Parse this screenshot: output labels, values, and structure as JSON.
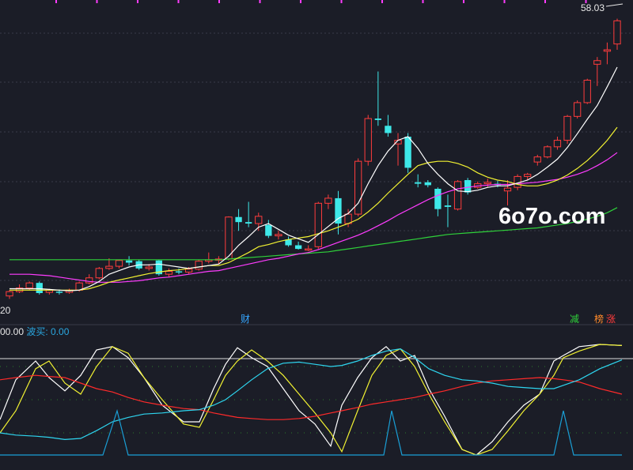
{
  "chart_data": {
    "type": "candlestick",
    "labels": {
      "high_price": "58.03",
      "left_value": "20",
      "finance_marker": "财",
      "reduce_marker": "减",
      "list_marker": "榜",
      "rise_marker": "涨",
      "indicator_value1": "00.00",
      "indicator_name": "波买:",
      "indicator_value2": " 0.00",
      "watermark": "6o7o.com"
    },
    "price_range": [
      18,
      60
    ],
    "indicator_range": [
      0,
      100
    ],
    "colors": {
      "background": "#1b1d27",
      "up": "#ff3c3c",
      "down": "#3ee8e8",
      "ma_fast": "#ffffff",
      "ma_mid": "#f2f232",
      "ma_slow": "#ff3cff",
      "ma_long": "#2fd23a",
      "k_line": "#ffffff",
      "d_line": "#f2f232",
      "slow_line": "#ff2a2a",
      "cyan_line": "#2ed6f0",
      "signal_line": "#1a9fd6",
      "grid": "#8a2a6a",
      "level_line": "#dddddd"
    },
    "candles": [
      [
        20.0,
        20.8,
        19.6,
        20.6
      ],
      [
        20.6,
        21.6,
        20.4,
        21.1
      ],
      [
        21.1,
        22.0,
        20.8,
        21.8
      ],
      [
        21.8,
        22.0,
        20.2,
        20.4
      ],
      [
        20.5,
        21.0,
        20.2,
        20.8
      ],
      [
        20.6,
        20.9,
        20.2,
        20.5
      ],
      [
        20.5,
        21.0,
        20.3,
        20.8
      ],
      [
        20.8,
        22.0,
        20.6,
        21.8
      ],
      [
        21.8,
        23.0,
        21.6,
        22.5
      ],
      [
        22.5,
        24.0,
        22.3,
        23.8
      ],
      [
        23.8,
        25.2,
        23.6,
        24.1
      ],
      [
        24.1,
        25.0,
        23.8,
        24.9
      ],
      [
        24.9,
        25.5,
        24.2,
        24.6
      ],
      [
        24.8,
        25.0,
        23.6,
        23.8
      ],
      [
        23.8,
        24.4,
        23.5,
        24.0
      ],
      [
        24.9,
        25.0,
        22.8,
        23.0
      ],
      [
        23.0,
        23.8,
        22.6,
        23.4
      ],
      [
        23.4,
        23.8,
        23.0,
        23.3
      ],
      [
        23.3,
        24.0,
        23.0,
        23.7
      ],
      [
        23.7,
        25.0,
        23.5,
        24.8
      ],
      [
        24.8,
        26.0,
        24.5,
        25.0
      ],
      [
        25.0,
        25.5,
        24.4,
        25.1
      ],
      [
        25.1,
        31.0,
        24.9,
        30.9
      ],
      [
        30.9,
        32.0,
        29.0,
        30.2
      ],
      [
        30.2,
        33.0,
        29.5,
        30.0
      ],
      [
        30.0,
        31.5,
        29.0,
        31.0
      ],
      [
        29.8,
        30.5,
        28.0,
        28.3
      ],
      [
        28.3,
        29.0,
        27.8,
        28.5
      ],
      [
        27.8,
        28.2,
        26.8,
        27.0
      ],
      [
        27.0,
        27.5,
        26.4,
        26.5
      ],
      [
        26.5,
        27.0,
        26.2,
        26.5
      ],
      [
        26.8,
        33.0,
        26.5,
        32.8
      ],
      [
        32.8,
        34.0,
        32.0,
        33.5
      ],
      [
        33.5,
        34.5,
        28.5,
        30.0
      ],
      [
        30.0,
        32.0,
        29.5,
        31.3
      ],
      [
        31.3,
        39.0,
        31.0,
        38.6
      ],
      [
        38.6,
        45.0,
        38.0,
        44.5
      ],
      [
        44.5,
        51.0,
        43.5,
        44.3
      ],
      [
        43.5,
        45.0,
        42.0,
        42.5
      ],
      [
        41.0,
        42.5,
        38.0,
        41.5
      ],
      [
        42.0,
        42.5,
        37.0,
        37.7
      ],
      [
        35.7,
        36.8,
        35.0,
        35.5
      ],
      [
        35.7,
        36.0,
        35.0,
        35.3
      ],
      [
        34.8,
        35.0,
        31.0,
        32.0
      ],
      [
        32.5,
        34.0,
        29.5,
        32.3
      ],
      [
        32.0,
        36.0,
        31.8,
        35.8
      ],
      [
        36.0,
        36.3,
        34.0,
        34.3
      ],
      [
        35.0,
        35.8,
        34.8,
        35.5
      ],
      [
        35.5,
        36.2,
        35.0,
        35.7
      ],
      [
        35.5,
        35.9,
        35.0,
        35.3
      ],
      [
        34.5,
        36.0,
        32.5,
        34.9
      ],
      [
        35.0,
        36.8,
        34.6,
        36.5
      ],
      [
        36.5,
        37.0,
        36.0,
        36.8
      ],
      [
        38.5,
        39.5,
        38.0,
        39.2
      ],
      [
        39.2,
        40.8,
        39.0,
        40.6
      ],
      [
        40.6,
        42.0,
        40.2,
        41.5
      ],
      [
        41.5,
        45.0,
        41.0,
        44.8
      ],
      [
        44.8,
        47.0,
        44.5,
        46.7
      ],
      [
        46.7,
        50.0,
        46.5,
        49.8
      ],
      [
        52.0,
        53.0,
        49.0,
        52.5
      ],
      [
        53.8,
        55.0,
        52.0,
        54.0
      ],
      [
        54.8,
        58.3,
        54.0,
        58.0
      ]
    ],
    "ma5": [
      21.0,
      21.0,
      21.0,
      21.0,
      20.9,
      20.8,
      20.7,
      20.8,
      21.3,
      22.0,
      23.0,
      23.5,
      24.0,
      24.3,
      24.3,
      24.4,
      24.2,
      24.0,
      23.8,
      24.0,
      24.2,
      24.4,
      25.5,
      27.0,
      28.2,
      29.5,
      30.0,
      29.2,
      28.4,
      27.9,
      27.4,
      28.5,
      29.6,
      30.7,
      31.4,
      32.8,
      35.5,
      38.0,
      40.0,
      41.5,
      42.0,
      40.4,
      38.3,
      36.8,
      35.5,
      34.5,
      34.4,
      34.6,
      35.0,
      35.2,
      35.2,
      35.6,
      36.0,
      36.8,
      37.8,
      38.9,
      40.5,
      42.4,
      44.4,
      46.3,
      48.9,
      51.6
    ],
    "ma10": [
      20.8,
      20.8,
      20.8,
      20.8,
      20.8,
      20.8,
      20.8,
      20.8,
      21.0,
      21.4,
      21.9,
      22.2,
      22.5,
      22.8,
      23.1,
      23.3,
      23.5,
      23.6,
      23.8,
      24.0,
      24.2,
      24.2,
      24.6,
      25.3,
      26.0,
      26.8,
      27.1,
      27.5,
      27.8,
      28.0,
      28.2,
      28.6,
      29.0,
      29.5,
      30.0,
      30.6,
      31.6,
      32.8,
      34.2,
      35.5,
      36.8,
      38.0,
      38.4,
      38.6,
      38.6,
      38.3,
      37.8,
      37.0,
      36.4,
      36.0,
      35.8,
      35.4,
      35.2,
      35.2,
      35.5,
      36.0,
      36.7,
      37.6,
      38.7,
      40.0,
      41.5,
      43.3
    ],
    "ma20": [
      23.0,
      23.0,
      23.0,
      22.9,
      22.8,
      22.6,
      22.4,
      22.2,
      22.0,
      21.9,
      21.9,
      21.9,
      22.0,
      22.1,
      22.3,
      22.5,
      22.6,
      22.8,
      23.0,
      23.2,
      23.4,
      23.5,
      23.8,
      24.1,
      24.4,
      24.7,
      25.0,
      25.2,
      25.5,
      25.8,
      26.0,
      26.4,
      26.9,
      27.4,
      27.9,
      28.4,
      29.0,
      29.7,
      30.4,
      31.2,
      31.9,
      32.6,
      33.3,
      33.9,
      34.4,
      34.8,
      35.0,
      35.2,
      35.3,
      35.4,
      35.4,
      35.5,
      35.6,
      35.7,
      35.9,
      36.1,
      36.4,
      36.8,
      37.3,
      38.0,
      38.8,
      39.8
    ],
    "ma60": [
      25.0,
      25.0,
      25.0,
      25.0,
      25.0,
      25.0,
      25.0,
      25.0,
      25.0,
      25.0,
      25.0,
      25.0,
      25.0,
      25.0,
      25.0,
      25.0,
      25.0,
      25.0,
      25.0,
      25.0,
      25.0,
      25.0,
      25.1,
      25.2,
      25.3,
      25.4,
      25.5,
      25.6,
      25.7,
      25.8,
      25.9,
      26.0,
      26.1,
      26.3,
      26.5,
      26.7,
      26.9,
      27.1,
      27.3,
      27.5,
      27.7,
      27.9,
      28.1,
      28.3,
      28.5,
      28.6,
      28.7,
      28.8,
      28.9,
      29.0,
      29.1,
      29.2,
      29.3,
      29.4,
      29.6,
      29.8,
      30.0,
      30.3,
      30.6,
      31.0,
      31.5,
      32.2
    ],
    "series": [
      {
        "key": "k",
        "values": [
          [
            0,
            32
          ],
          [
            20,
            68
          ],
          [
            45,
            85
          ],
          [
            62,
            70
          ],
          [
            82,
            58
          ],
          [
            102,
            72
          ],
          [
            122,
            95
          ],
          [
            142,
            98
          ],
          [
            162,
            88
          ],
          [
            182,
            70
          ],
          [
            205,
            45
          ],
          [
            232,
            30
          ],
          [
            252,
            30
          ],
          [
            270,
            60
          ],
          [
            285,
            82
          ],
          [
            300,
            97
          ],
          [
            318,
            88
          ],
          [
            338,
            80
          ],
          [
            358,
            60
          ],
          [
            378,
            40
          ],
          [
            398,
            28
          ],
          [
            418,
            8
          ],
          [
            432,
            45
          ],
          [
            452,
            70
          ],
          [
            470,
            88
          ],
          [
            488,
            98
          ],
          [
            506,
            85
          ],
          [
            524,
            90
          ],
          [
            542,
            60
          ],
          [
            562,
            35
          ],
          [
            584,
            5
          ],
          [
            602,
            0
          ],
          [
            622,
            12
          ],
          [
            642,
            30
          ],
          [
            662,
            45
          ],
          [
            682,
            55
          ],
          [
            700,
            85
          ],
          [
            712,
            90
          ],
          [
            732,
            98
          ],
          [
            758,
            100
          ],
          [
            786,
            99
          ]
        ]
      },
      {
        "key": "d",
        "values": [
          [
            0,
            20
          ],
          [
            20,
            40
          ],
          [
            45,
            78
          ],
          [
            62,
            85
          ],
          [
            82,
            65
          ],
          [
            102,
            55
          ],
          [
            122,
            80
          ],
          [
            142,
            98
          ],
          [
            162,
            92
          ],
          [
            182,
            70
          ],
          [
            205,
            50
          ],
          [
            232,
            28
          ],
          [
            252,
            25
          ],
          [
            270,
            50
          ],
          [
            285,
            72
          ],
          [
            300,
            85
          ],
          [
            318,
            95
          ],
          [
            338,
            85
          ],
          [
            358,
            72
          ],
          [
            378,
            55
          ],
          [
            398,
            38
          ],
          [
            418,
            20
          ],
          [
            432,
            3
          ],
          [
            452,
            40
          ],
          [
            470,
            72
          ],
          [
            488,
            90
          ],
          [
            506,
            96
          ],
          [
            524,
            80
          ],
          [
            542,
            55
          ],
          [
            562,
            30
          ],
          [
            584,
            5
          ],
          [
            602,
            0
          ],
          [
            622,
            5
          ],
          [
            642,
            22
          ],
          [
            662,
            40
          ],
          [
            682,
            55
          ],
          [
            700,
            72
          ],
          [
            712,
            88
          ],
          [
            732,
            94
          ],
          [
            758,
            100
          ],
          [
            786,
            99
          ]
        ]
      },
      {
        "key": "slow",
        "values": [
          [
            0,
            68
          ],
          [
            20,
            70
          ],
          [
            45,
            72
          ],
          [
            62,
            71
          ],
          [
            82,
            70
          ],
          [
            102,
            65
          ],
          [
            122,
            60
          ],
          [
            142,
            57
          ],
          [
            162,
            52
          ],
          [
            182,
            48
          ],
          [
            205,
            45
          ],
          [
            232,
            42
          ],
          [
            252,
            41
          ],
          [
            270,
            38
          ],
          [
            285,
            36
          ],
          [
            300,
            34
          ],
          [
            318,
            33
          ],
          [
            338,
            32
          ],
          [
            358,
            32
          ],
          [
            378,
            33
          ],
          [
            398,
            35
          ],
          [
            418,
            38
          ],
          [
            432,
            40
          ],
          [
            452,
            43
          ],
          [
            470,
            46
          ],
          [
            488,
            48
          ],
          [
            506,
            50
          ],
          [
            524,
            52
          ],
          [
            542,
            55
          ],
          [
            562,
            58
          ],
          [
            584,
            62
          ],
          [
            602,
            65
          ],
          [
            622,
            67
          ],
          [
            642,
            68
          ],
          [
            662,
            69
          ],
          [
            682,
            70
          ],
          [
            700,
            69
          ],
          [
            712,
            68
          ],
          [
            732,
            66
          ],
          [
            758,
            60
          ],
          [
            786,
            55
          ]
        ]
      },
      {
        "key": "cyan",
        "values": [
          [
            0,
            20
          ],
          [
            20,
            18
          ],
          [
            45,
            17
          ],
          [
            62,
            16
          ],
          [
            82,
            14
          ],
          [
            102,
            15
          ],
          [
            122,
            22
          ],
          [
            142,
            30
          ],
          [
            162,
            34
          ],
          [
            182,
            37
          ],
          [
            205,
            38
          ],
          [
            232,
            40
          ],
          [
            252,
            41
          ],
          [
            270,
            45
          ],
          [
            285,
            50
          ],
          [
            300,
            58
          ],
          [
            318,
            68
          ],
          [
            338,
            78
          ],
          [
            358,
            83
          ],
          [
            378,
            84
          ],
          [
            398,
            82
          ],
          [
            418,
            80
          ],
          [
            432,
            81
          ],
          [
            452,
            85
          ],
          [
            470,
            90
          ],
          [
            488,
            94
          ],
          [
            506,
            96
          ],
          [
            524,
            88
          ],
          [
            542,
            78
          ],
          [
            562,
            72
          ],
          [
            584,
            68
          ],
          [
            602,
            67
          ],
          [
            622,
            65
          ],
          [
            642,
            62
          ],
          [
            662,
            61
          ],
          [
            682,
            60
          ],
          [
            700,
            60
          ],
          [
            712,
            63
          ],
          [
            732,
            68
          ],
          [
            758,
            78
          ],
          [
            786,
            86
          ]
        ]
      },
      {
        "key": "signal",
        "values": [
          [
            0,
            0
          ],
          [
            130,
            0
          ],
          [
            148,
            40
          ],
          [
            162,
            0
          ],
          [
            485,
            0
          ],
          [
            495,
            40
          ],
          [
            508,
            0
          ],
          [
            700,
            0
          ],
          [
            712,
            40
          ],
          [
            725,
            0
          ],
          [
            786,
            0
          ]
        ]
      }
    ]
  }
}
